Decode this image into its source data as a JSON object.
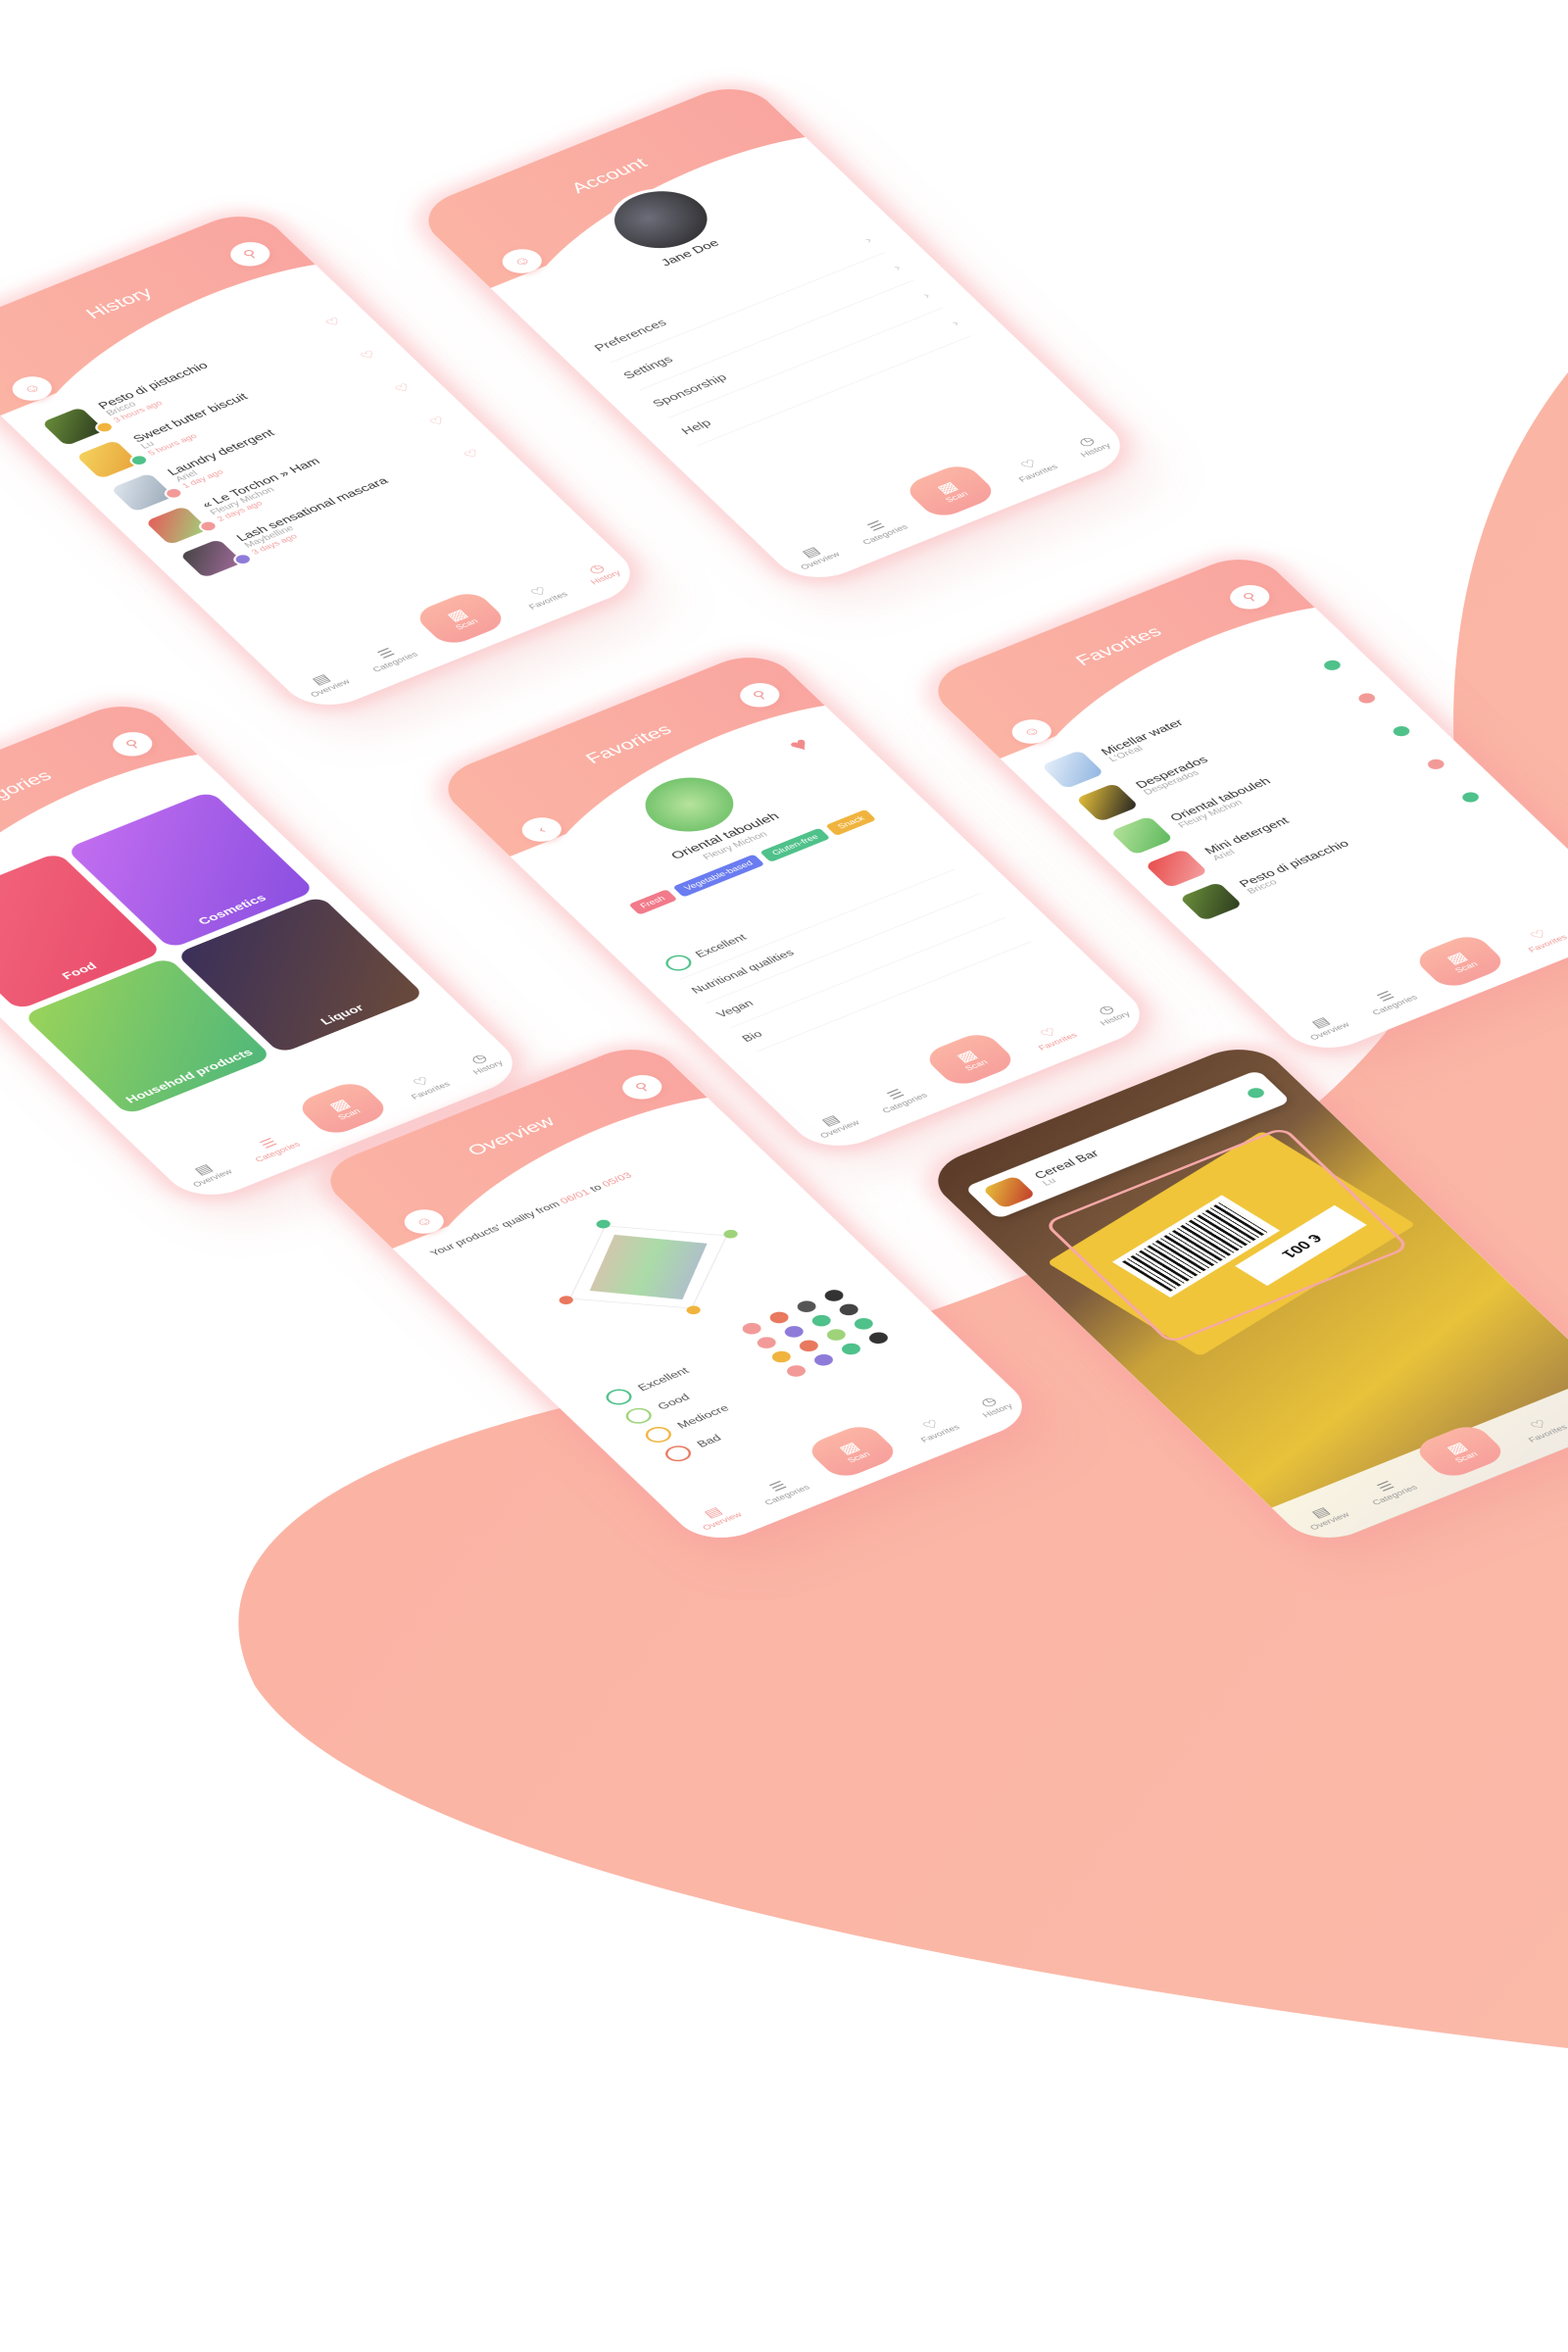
{
  "palette": {
    "accent": "#f7a09c",
    "accent_light": "#fbb4a4",
    "blob": "#fbb6a6"
  },
  "tabs": {
    "overview": "Overview",
    "categories": "Categories",
    "scan": "Scan",
    "favorites": "Favorites",
    "history": "History"
  },
  "history": {
    "title": "History",
    "items": [
      {
        "name": "Pesto di pistacchio",
        "brand": "Bricco",
        "ago": "3 hours ago",
        "status": "#f0b43e"
      },
      {
        "name": "Sweet butter biscuit",
        "brand": "Lu",
        "ago": "5 hours ago",
        "status": "#4fc18a"
      },
      {
        "name": "Laundry detergent",
        "brand": "Ariel",
        "ago": "1 day ago",
        "status": "#f29a98"
      },
      {
        "name": "« Le Torchon » Ham",
        "brand": "Fleury Michon",
        "ago": "2 days ago",
        "status": "#f29a98"
      },
      {
        "name": "Lash sensational mascara",
        "brand": "Maybelline",
        "ago": "3 days ago",
        "status": "#8e7bd9"
      }
    ]
  },
  "account": {
    "title": "Account",
    "user_name": "Jane Doe",
    "menu": [
      "Preferences",
      "Settings",
      "Sponsorship",
      "Help"
    ]
  },
  "categories": {
    "title": "Categories",
    "items": [
      "Food",
      "Cosmetics",
      "Household products",
      "Liquor"
    ]
  },
  "product": {
    "title": "Favorites",
    "name": "Oriental tabouleh",
    "brand": "Fleury Michon",
    "tags": [
      "Fresh",
      "Vegetable-based",
      "Gluten-free",
      "Snack"
    ],
    "rows": [
      "Excellent",
      "Nutritional qualities",
      "Vegan",
      "Bio"
    ]
  },
  "favorites": {
    "title": "Favorites",
    "items": [
      {
        "name": "Micellar water",
        "brand": "L'Oréal",
        "status": "#4fc18a"
      },
      {
        "name": "Desperados",
        "brand": "Desperados",
        "status": "#f29a98"
      },
      {
        "name": "Oriental tabouleh",
        "brand": "Fleury Michon",
        "status": "#4fc18a"
      },
      {
        "name": "Mini detergent",
        "brand": "Ariel",
        "status": "#f29a98"
      },
      {
        "name": "Pesto di pistacchio",
        "brand": "Bricco",
        "status": "#4fc18a"
      }
    ]
  },
  "overview": {
    "title": "Overview",
    "text_prefix": "Your products' quality from",
    "date_from": "06/01",
    "text_mid": "to",
    "date_to": "05/03",
    "legend": [
      {
        "label": "Excellent",
        "color": "#4fc18a"
      },
      {
        "label": "Good",
        "color": "#9ed37a"
      },
      {
        "label": "Mediocre",
        "color": "#f0b43e"
      },
      {
        "label": "Bad",
        "color": "#e8785e"
      }
    ]
  },
  "scanner": {
    "card_name": "Cereal Bar",
    "card_brand": "Lu",
    "price": "€ 001"
  }
}
